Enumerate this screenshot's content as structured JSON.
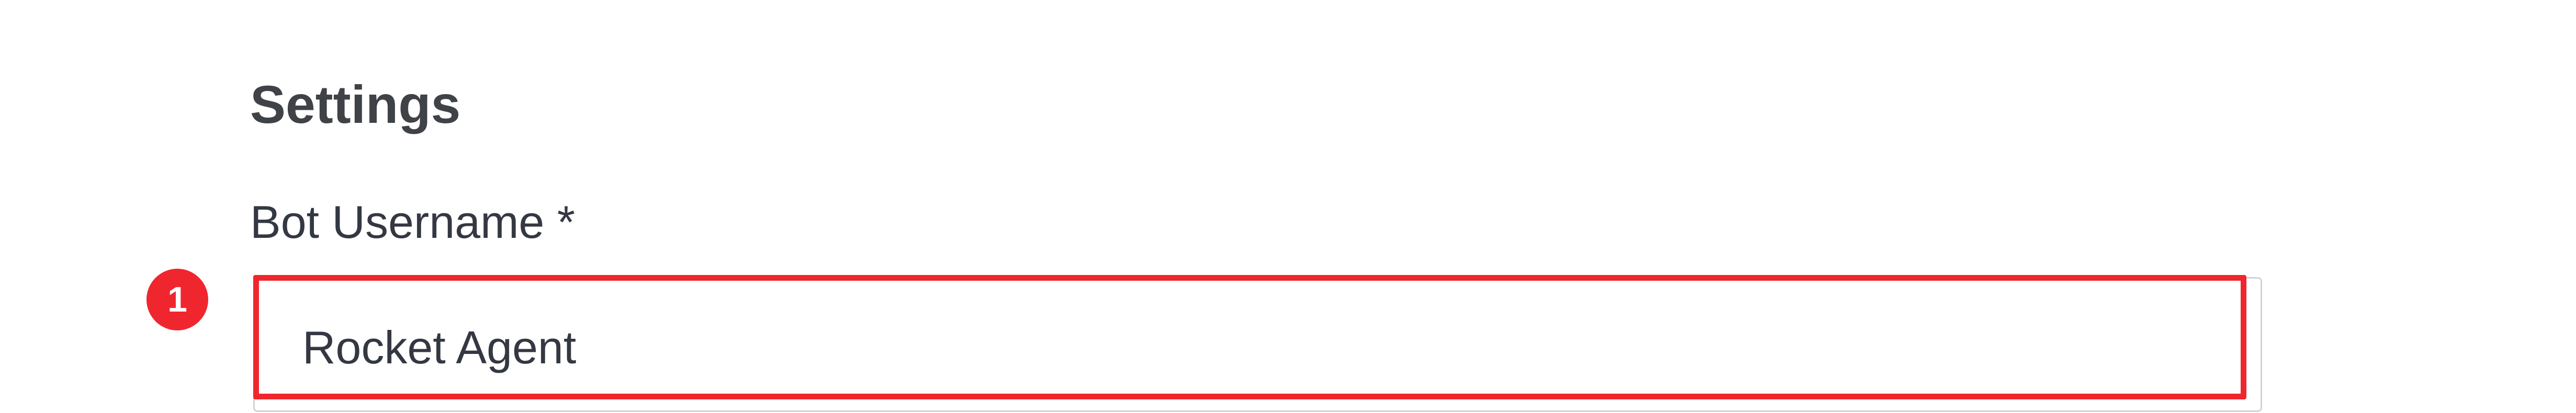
{
  "settings": {
    "title": "Settings"
  },
  "bot_username": {
    "label": "Bot Username *",
    "value": "Rocket Agent",
    "required": true
  },
  "annotation": {
    "step_number": "1",
    "color": "#f0262e"
  }
}
